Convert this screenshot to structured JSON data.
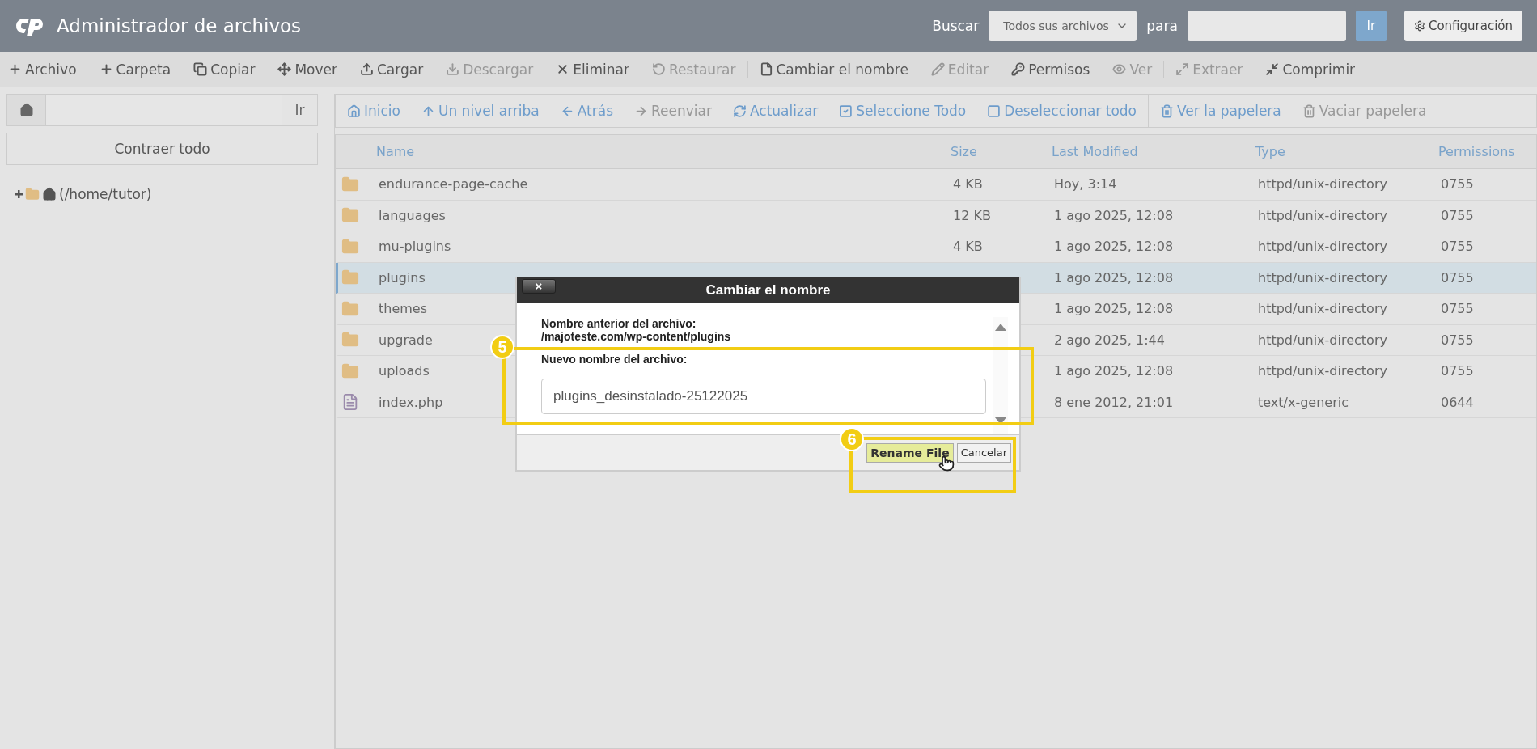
{
  "header": {
    "title": "Administrador de archivos",
    "search_label": "Buscar",
    "search_scope": "Todos sus archivos",
    "for_label": "para",
    "go_button": "Ir",
    "settings_button": "Configuración"
  },
  "toolbar": {
    "groups": [
      [
        {
          "label": "Archivo",
          "disabled": false
        },
        {
          "label": "Carpeta",
          "disabled": false
        },
        {
          "label": "Copiar",
          "disabled": false
        },
        {
          "label": "Mover",
          "disabled": false
        },
        {
          "label": "Cargar",
          "disabled": false
        },
        {
          "label": "Descargar",
          "disabled": true
        },
        {
          "label": "Eliminar",
          "disabled": false
        },
        {
          "label": "Restaurar",
          "disabled": true
        }
      ],
      [
        {
          "label": "Cambiar el nombre",
          "disabled": false
        },
        {
          "label": "Editar",
          "disabled": true
        },
        {
          "label": "Permisos",
          "disabled": false
        },
        {
          "label": "Ver",
          "disabled": true
        }
      ],
      [
        {
          "label": "Extraer",
          "disabled": true
        },
        {
          "label": "Comprimir",
          "disabled": false
        }
      ]
    ]
  },
  "sidebar": {
    "go_button": "Ir",
    "collapse_button": "Contraer todo",
    "tree": [
      {
        "label": "(/home/tutor)",
        "expanded": false
      }
    ]
  },
  "nav": {
    "groups": [
      [
        {
          "label": "Inicio",
          "disabled": false
        },
        {
          "label": "Un nivel arriba",
          "disabled": false
        },
        {
          "label": "Atrás",
          "disabled": false
        },
        {
          "label": "Reenviar",
          "disabled": true
        },
        {
          "label": "Actualizar",
          "disabled": false
        },
        {
          "label": "Seleccione Todo",
          "disabled": false
        },
        {
          "label": "Deseleccionar todo",
          "disabled": false
        }
      ],
      [
        {
          "label": "Ver la papelera",
          "disabled": false
        },
        {
          "label": "Vaciar papelera",
          "disabled": true
        }
      ]
    ]
  },
  "table": {
    "columns": [
      "Name",
      "Size",
      "Last Modified",
      "Type",
      "Permissions"
    ],
    "rows": [
      {
        "kind": "folder",
        "selected": false,
        "name": "endurance-page-cache",
        "size": "4 KB",
        "modified": "Hoy, 3:14",
        "type": "httpd/unix-directory",
        "permissions": "0755"
      },
      {
        "kind": "folder",
        "selected": false,
        "name": "languages",
        "size": "12 KB",
        "modified": "1 ago 2025, 12:08",
        "type": "httpd/unix-directory",
        "permissions": "0755"
      },
      {
        "kind": "folder",
        "selected": false,
        "name": "mu-plugins",
        "size": "4 KB",
        "modified": "1 ago 2025, 12:08",
        "type": "httpd/unix-directory",
        "permissions": "0755"
      },
      {
        "kind": "folder",
        "selected": true,
        "name": "plugins",
        "modified": "1 ago 2025, 12:08",
        "type": "httpd/unix-directory",
        "permissions": "0755"
      },
      {
        "kind": "folder",
        "selected": false,
        "name": "themes",
        "modified": "1 ago 2025, 12:08",
        "type": "httpd/unix-directory",
        "permissions": "0755"
      },
      {
        "kind": "folder",
        "selected": false,
        "name": "upgrade",
        "modified": "2 ago 2025, 1:44",
        "type": "httpd/unix-directory",
        "permissions": "0755"
      },
      {
        "kind": "folder",
        "selected": false,
        "name": "uploads",
        "modified": "1 ago 2025, 12:08",
        "type": "httpd/unix-directory",
        "permissions": "0755"
      },
      {
        "kind": "file",
        "selected": false,
        "name": "index.php",
        "modified": "8 ene 2012, 21:01",
        "type": "text/x-generic",
        "permissions": "0644"
      }
    ]
  },
  "dialog": {
    "close_button": "×",
    "title": "Cambiar el nombre",
    "old_name_label": "Nombre anterior del archivo:",
    "old_name": "/majoteste.com/wp-content/plugins",
    "new_name_label": "Nuevo nombre del archivo:",
    "new_name": "plugins_desinstalado-25122025",
    "confirm_button": "Rename File",
    "cancel_button": "Cancelar"
  },
  "annotations": [
    {
      "label": "5"
    },
    {
      "label": "6"
    }
  ]
}
